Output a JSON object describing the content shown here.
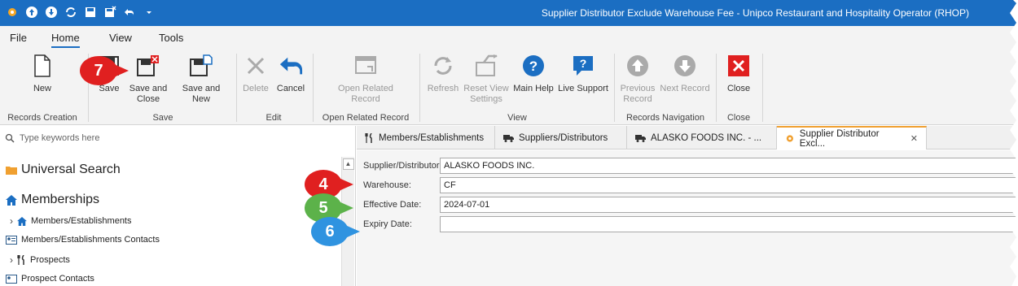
{
  "window": {
    "title": "Supplier Distributor Exclude Warehouse Fee - Unipco Restaurant and Hospitality Operator (RHOP)"
  },
  "menu": {
    "tabs": [
      "File",
      "Home",
      "View",
      "Tools"
    ],
    "active": "Home"
  },
  "ribbon": {
    "buttons": {
      "new": "New",
      "save": "Save",
      "save_close": "Save and Close",
      "save_new": "Save and New",
      "delete": "Delete",
      "cancel": "Cancel",
      "open_related": "Open Related Record",
      "refresh": "Refresh",
      "reset_view": "Reset View Settings",
      "main_help": "Main Help",
      "live_support": "Live Support",
      "previous_record": "Previous Record",
      "next_record": "Next Record",
      "close": "Close"
    },
    "groups": {
      "records_creation": "Records Creation",
      "save": "Save",
      "edit": "Edit",
      "open_related": "Open Related Record",
      "view": "View",
      "records_navigation": "Records Navigation",
      "close": "Close"
    }
  },
  "sidebar": {
    "search_placeholder": "Type keywords here",
    "universal_search": "Universal Search",
    "memberships": "Memberships",
    "members_establishments": "Members/Establishments",
    "members_contacts": "Members/Establishments Contacts",
    "prospects": "Prospects",
    "prospect_contacts": "Prospect Contacts"
  },
  "doc_tabs": [
    "Members/Establishments",
    "Suppliers/Distributors",
    "ALASKO FOODS INC. - ...",
    "Supplier Distributor Excl..."
  ],
  "form": {
    "supplier_label": "Supplier/Distributor:",
    "supplier_value": "ALASKO FOODS INC.",
    "warehouse_label": "Warehouse:",
    "warehouse_value": "CF",
    "effective_label": "Effective Date:",
    "effective_value": "2024-07-01",
    "expiry_label": "Expiry Date:",
    "expiry_value": ""
  },
  "callouts": {
    "c7": "7",
    "c4": "4",
    "c5": "5",
    "c6": "6"
  },
  "colors": {
    "titlebar": "#1b6ec2",
    "callout_red": "#e02020",
    "callout_green": "#5cb24a",
    "callout_blue": "#2f93e0"
  }
}
